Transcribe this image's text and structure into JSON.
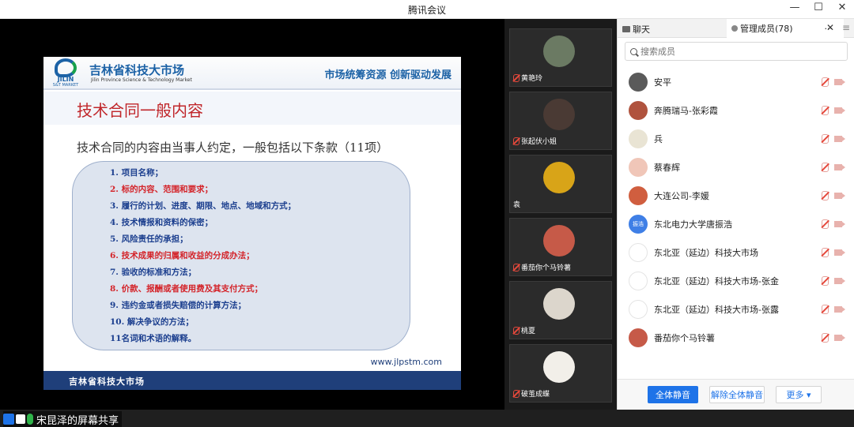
{
  "window": {
    "title": "腾讯会议",
    "controls": [
      "—",
      "☐",
      "✕"
    ]
  },
  "slide": {
    "org_cn": "吉林省科技大市场",
    "org_en": "Jilin Province Science & Technology Market",
    "logo_text": "JILIN",
    "logo_sub": "S&T MARKET",
    "slogan": "市场统筹资源 创新驱动发展",
    "title": "技术合同一般内容",
    "subtitle": "技术合同的内容由当事人约定，一般包括以下条款（11项）",
    "items": [
      {
        "text": "1. 项目名称；",
        "color": "#1c3f8f"
      },
      {
        "text": "2. 标的内容、范围和要求；",
        "color": "#d4242a"
      },
      {
        "text": "3. 履行的计划、进度、期限、地点、地域和方式；",
        "color": "#1c3f8f"
      },
      {
        "text": "4. 技术情报和资料的保密；",
        "color": "#1c3f8f"
      },
      {
        "text": "5. 风险责任的承担；",
        "color": "#1c3f8f"
      },
      {
        "text": "6. 技术成果的归属和收益的分成办法；",
        "color": "#d4242a"
      },
      {
        "text": "7. 验收的标准和方法；",
        "color": "#1c3f8f"
      },
      {
        "text": "8. 价款、报酬或者使用费及其支付方式；",
        "color": "#d4242a"
      },
      {
        "text": "9. 违约金或者损失赔偿的计算方法；",
        "color": "#1c3f8f"
      },
      {
        "text": "10. 解决争议的方法；",
        "color": "#1c3f8f"
      },
      {
        "text": "11名词和术语的解释。",
        "color": "#1c3f8f"
      }
    ],
    "footer_org": "吉林省科技大市场",
    "footer_url": "www.jlpstm.com"
  },
  "share_label": "宋昆泽的屏幕共享",
  "video_tiles": [
    {
      "name": "黄艳玲",
      "avatar": "photo-icon",
      "color": "#6b7a63",
      "muted": true
    },
    {
      "name": "张起伏小姐",
      "avatar": "photo-icon",
      "color": "#4a3a34",
      "muted": true
    },
    {
      "name": "袁",
      "avatar": "sunflower-icon",
      "color": "#d8a418",
      "muted": false
    },
    {
      "name": "番茄你个马铃薯",
      "avatar": "anime-girl-icon",
      "color": "#c65a48",
      "muted": true
    },
    {
      "name": "桃夏",
      "avatar": "photo-icon",
      "color": "#dcd6cc",
      "muted": true
    },
    {
      "name": "破茧成蝶",
      "avatar": "cartoon-icon",
      "color": "#f2efe9",
      "muted": true
    }
  ],
  "panel": {
    "tab_chat": "聊天",
    "tab_members": "管理成员(78)",
    "tab_more": "···",
    "tab_close": "✕",
    "tab_menu": "≡",
    "search_placeholder": "搜索成员",
    "members": [
      {
        "name": "安平",
        "avatar_color": "#5a5a5a",
        "avatar_text": ""
      },
      {
        "name": "奔腾瑞马-张彩霞",
        "avatar_color": "#b0533e",
        "avatar_text": ""
      },
      {
        "name": "兵",
        "avatar_color": "#e9e4d4",
        "avatar_text": ""
      },
      {
        "name": "蔡春辉",
        "avatar_color": "#f0c6b8",
        "avatar_text": ""
      },
      {
        "name": "大连公司-李媛",
        "avatar_color": "#d05e3f",
        "avatar_text": ""
      },
      {
        "name": "东北电力大学唐振浩",
        "avatar_color": "#3f7fe6",
        "avatar_text": "振浩"
      },
      {
        "name": "东北亚（延边）科技大市场",
        "avatar_color": "#ffffff",
        "avatar_text": ""
      },
      {
        "name": "东北亚（延边）科技大市场-张金",
        "avatar_color": "#ffffff",
        "avatar_text": ""
      },
      {
        "name": "东北亚（延边）科技大市场-张露",
        "avatar_color": "#ffffff",
        "avatar_text": ""
      },
      {
        "name": "番茄你个马铃薯",
        "avatar_color": "#c65a48",
        "avatar_text": ""
      }
    ],
    "btn_mute_all": "全体静音",
    "btn_unmute_all": "解除全体静音",
    "btn_more": "更多 ▾"
  }
}
